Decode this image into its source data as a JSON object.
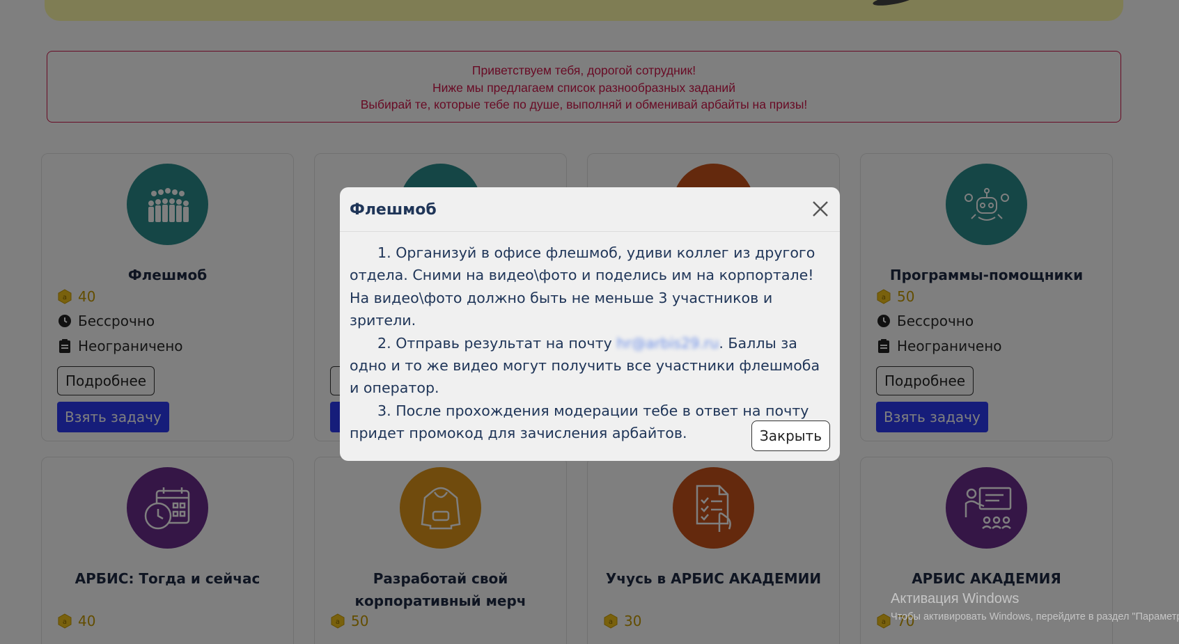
{
  "welcome": {
    "line1": "Приветствуем тебя, дорогой сотрудник!",
    "line2": "Ниже мы предлагаем список разнообразных заданий",
    "line3": "Выбирай те, которые тебе по душе, выполняй и обменивай арбайты на призы!"
  },
  "cards_top": [
    {
      "title": "Флешмоб",
      "points": "40",
      "deadline": "Бессрочно",
      "limit": "Неограничено",
      "more": "Подробнее",
      "take": "Взять задачу",
      "color": "#2a8c8c",
      "icon": "crowd-icon"
    },
    {
      "title": "",
      "points": "",
      "deadline": "",
      "limit": "",
      "more": "",
      "take": "",
      "color": "#2a8c8c",
      "icon": "task-icon"
    },
    {
      "title": "",
      "points": "",
      "deadline": "",
      "limit": "",
      "more": "",
      "take": "",
      "color": "#c9531a",
      "icon": "globe-icon"
    },
    {
      "title": "Программы-помощники",
      "points": "50",
      "deadline": "Бессрочно",
      "limit": "Неограничено",
      "more": "Подробнее",
      "take": "Взять задачу",
      "color": "#2a8c8c",
      "icon": "robot-icon"
    }
  ],
  "cards_bottom": [
    {
      "title": "АРБИС: Тогда и сейчас",
      "points": "40",
      "color": "#6b2c8c",
      "icon": "calendar-clock-icon"
    },
    {
      "title": "Разработай свой корпоративный мерч",
      "points": "50",
      "color": "#e0961a",
      "icon": "hoodie-icon"
    },
    {
      "title": "Учусь в АРБИС АКАДЕМИИ",
      "points": "30",
      "color": "#c9531a",
      "icon": "checklist-icon"
    },
    {
      "title": "АРБИС АКАДЕМИЯ",
      "points": "70",
      "color": "#6b2c8c",
      "icon": "teacher-icon"
    }
  ],
  "modal": {
    "title": "Флешмоб",
    "p1": "1. Организуй в офисе флешмоб, удиви коллег из другого отдела. Сними на видео\\фото и поделись им на корпортале! На видео\\фото должно быть не меньше 3 участников и зрители.",
    "p2_before": "2. Отправь результат на почту ",
    "p2_email": "hr@arbis29.ru",
    "p2_after": ". Баллы за одно и то же видео могут получить все участники флешмоба и оператор.",
    "p3": "3. После прохождения модерации тебе в ответ на почту придет промокод для зачисления арбайтов.",
    "close_label": "Закрыть"
  },
  "watermark": {
    "title": "Активация Windows",
    "subtitle": "Чтобы активировать Windows, перейдите в раздел \"Параметры\"."
  }
}
